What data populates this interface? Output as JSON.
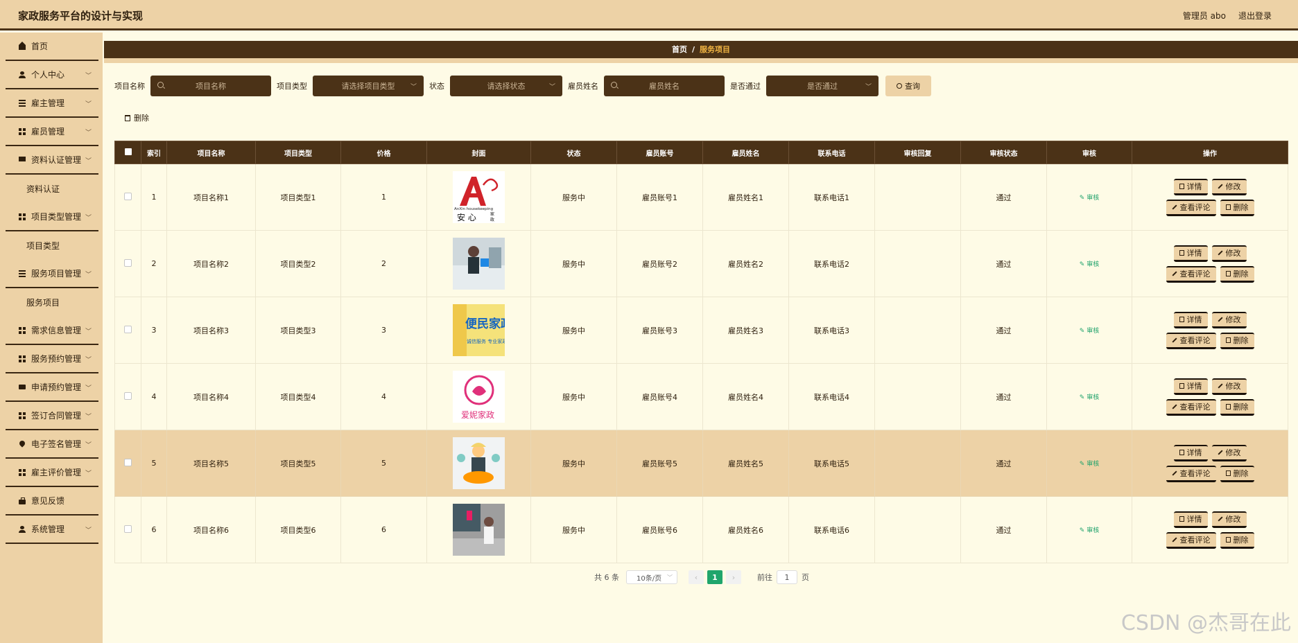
{
  "header": {
    "title": "家政服务平台的设计与实现",
    "user": "管理员 abo",
    "logout": "退出登录"
  },
  "sidebar": {
    "items": [
      {
        "label": "首页",
        "icon": "home-icon",
        "sub": false
      },
      {
        "label": "个人中心",
        "icon": "user-icon",
        "sub": true
      },
      {
        "label": "雇主管理",
        "icon": "list-icon",
        "sub": true
      },
      {
        "label": "雇员管理",
        "icon": "grid-icon",
        "sub": true
      },
      {
        "label": "资料认证管理",
        "icon": "monitor-icon",
        "sub": true
      },
      {
        "label": "资料认证",
        "child": true
      },
      {
        "label": "项目类型管理",
        "icon": "table-icon",
        "sub": true
      },
      {
        "label": "项目类型",
        "child": true
      },
      {
        "label": "服务项目管理",
        "icon": "list-icon",
        "sub": true
      },
      {
        "label": "服务项目",
        "child": true
      },
      {
        "label": "需求信息管理",
        "icon": "grid-icon",
        "sub": true
      },
      {
        "label": "服务预约管理",
        "icon": "grid-icon",
        "sub": true
      },
      {
        "label": "申请预约管理",
        "icon": "chat-icon",
        "sub": true
      },
      {
        "label": "签订合同管理",
        "icon": "grid-icon",
        "sub": true
      },
      {
        "label": "电子签名管理",
        "icon": "pin-icon",
        "sub": true
      },
      {
        "label": "雇主评价管理",
        "icon": "grid-icon",
        "sub": true
      },
      {
        "label": "意见反馈",
        "icon": "bag-icon",
        "sub": false
      },
      {
        "label": "系统管理",
        "icon": "user-icon",
        "sub": true
      }
    ]
  },
  "breadcrumb": {
    "home": "首页",
    "sep": "/",
    "current": "服务项目"
  },
  "search": {
    "name_label": "项目名称",
    "name_placeholder": "项目名称",
    "type_label": "项目类型",
    "type_placeholder": "请选择项目类型",
    "status_label": "状态",
    "status_placeholder": "请选择状态",
    "emp_label": "雇员姓名",
    "emp_placeholder": "雇员姓名",
    "pass_label": "是否通过",
    "pass_placeholder": "是否通过",
    "query": "查询"
  },
  "toolbar": {
    "delete": "删除"
  },
  "table": {
    "headers": [
      "索引",
      "项目名称",
      "项目类型",
      "价格",
      "封面",
      "状态",
      "雇员账号",
      "雇员姓名",
      "联系电话",
      "审核回复",
      "审核状态",
      "审核",
      "操作"
    ],
    "rows": [
      {
        "idx": "1",
        "name": "项目名称1",
        "type": "项目类型1",
        "price": "1",
        "status": "服务中",
        "acct": "雇员账号1",
        "emp": "雇员姓名1",
        "phone": "联系电话1",
        "reply": "",
        "audit_status": "通过",
        "cover_text": "AnXin housekeeping 安心 家政"
      },
      {
        "idx": "2",
        "name": "项目名称2",
        "type": "项目类型2",
        "price": "2",
        "status": "服务中",
        "acct": "雇员账号2",
        "emp": "雇员姓名2",
        "phone": "联系电话2",
        "reply": "",
        "audit_status": "通过",
        "cover_text": ""
      },
      {
        "idx": "3",
        "name": "项目名称3",
        "type": "项目类型3",
        "price": "3",
        "status": "服务中",
        "acct": "雇员账号3",
        "emp": "雇员姓名3",
        "phone": "联系电话3",
        "reply": "",
        "audit_status": "通过",
        "cover_text": "便民家政"
      },
      {
        "idx": "4",
        "name": "项目名称4",
        "type": "项目类型4",
        "price": "4",
        "status": "服务中",
        "acct": "雇员账号4",
        "emp": "雇员姓名4",
        "phone": "联系电话4",
        "reply": "",
        "audit_status": "通过",
        "cover_text": "爱妮家政"
      },
      {
        "idx": "5",
        "name": "项目名称5",
        "type": "项目类型5",
        "price": "5",
        "status": "服务中",
        "acct": "雇员账号5",
        "emp": "雇员姓名5",
        "phone": "联系电话5",
        "reply": "",
        "audit_status": "通过",
        "cover_text": ""
      },
      {
        "idx": "6",
        "name": "项目名称6",
        "type": "项目类型6",
        "price": "6",
        "status": "服务中",
        "acct": "雇员账号6",
        "emp": "雇员姓名6",
        "phone": "联系电话6",
        "reply": "",
        "audit_status": "通过",
        "cover_text": ""
      }
    ],
    "audit_link": "审核",
    "btn_detail": "详情",
    "btn_edit": "修改",
    "btn_review": "查看评论",
    "btn_delete": "删除"
  },
  "pagination": {
    "total": "共 6 条",
    "page_size": "10条/页",
    "current": "1",
    "goto_label": "前往",
    "goto_value": "1",
    "page_unit": "页"
  },
  "watermark": "CSDN @杰哥在此",
  "colors": {
    "header_bg": "#edd2a6",
    "dark_brown": "#4b3217",
    "content_bg": "#fefbe6",
    "accent_green": "#1fa56c",
    "breadcrumb_current": "#f0b442"
  }
}
